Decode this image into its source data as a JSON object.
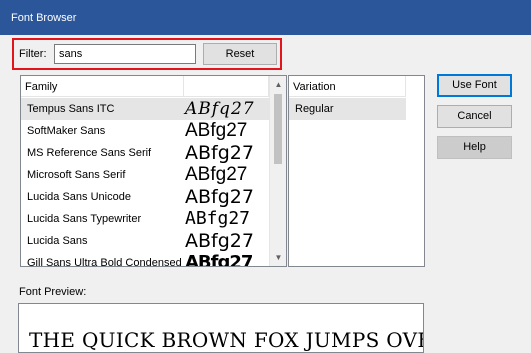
{
  "window": {
    "title": "Font Browser"
  },
  "filter": {
    "label": "Filter:",
    "value": "sans",
    "reset_label": "Reset"
  },
  "family_list": {
    "columns": [
      "Family",
      ""
    ],
    "rows": [
      {
        "name": "Tempus Sans ITC",
        "sample": "ABfq27"
      },
      {
        "name": "SoftMaker Sans",
        "sample": "ABfg27"
      },
      {
        "name": "MS Reference Sans Serif",
        "sample": "ABfg27"
      },
      {
        "name": "Microsoft Sans Serif",
        "sample": "ABfg27"
      },
      {
        "name": "Lucida Sans Unicode",
        "sample": "ABfg27"
      },
      {
        "name": "Lucida Sans Typewriter",
        "sample": "ABfg27"
      },
      {
        "name": "Lucida Sans",
        "sample": "ABfg27"
      },
      {
        "name": "Gill Sans Ultra Bold Condensed",
        "sample": "ABfg27"
      }
    ],
    "selected_index": 0
  },
  "variation_list": {
    "header": "Variation",
    "items": [
      "Regular"
    ]
  },
  "buttons": {
    "use_font": "Use Font",
    "cancel": "Cancel",
    "help": "Help"
  },
  "preview": {
    "label": "Font Preview:",
    "text": "THE QUICK BROWN FOX JUMPS OVER THE"
  },
  "colors": {
    "titlebar": "#2b579a",
    "filter_highlight": "#e3141b",
    "selection": "#e5e5e5"
  }
}
